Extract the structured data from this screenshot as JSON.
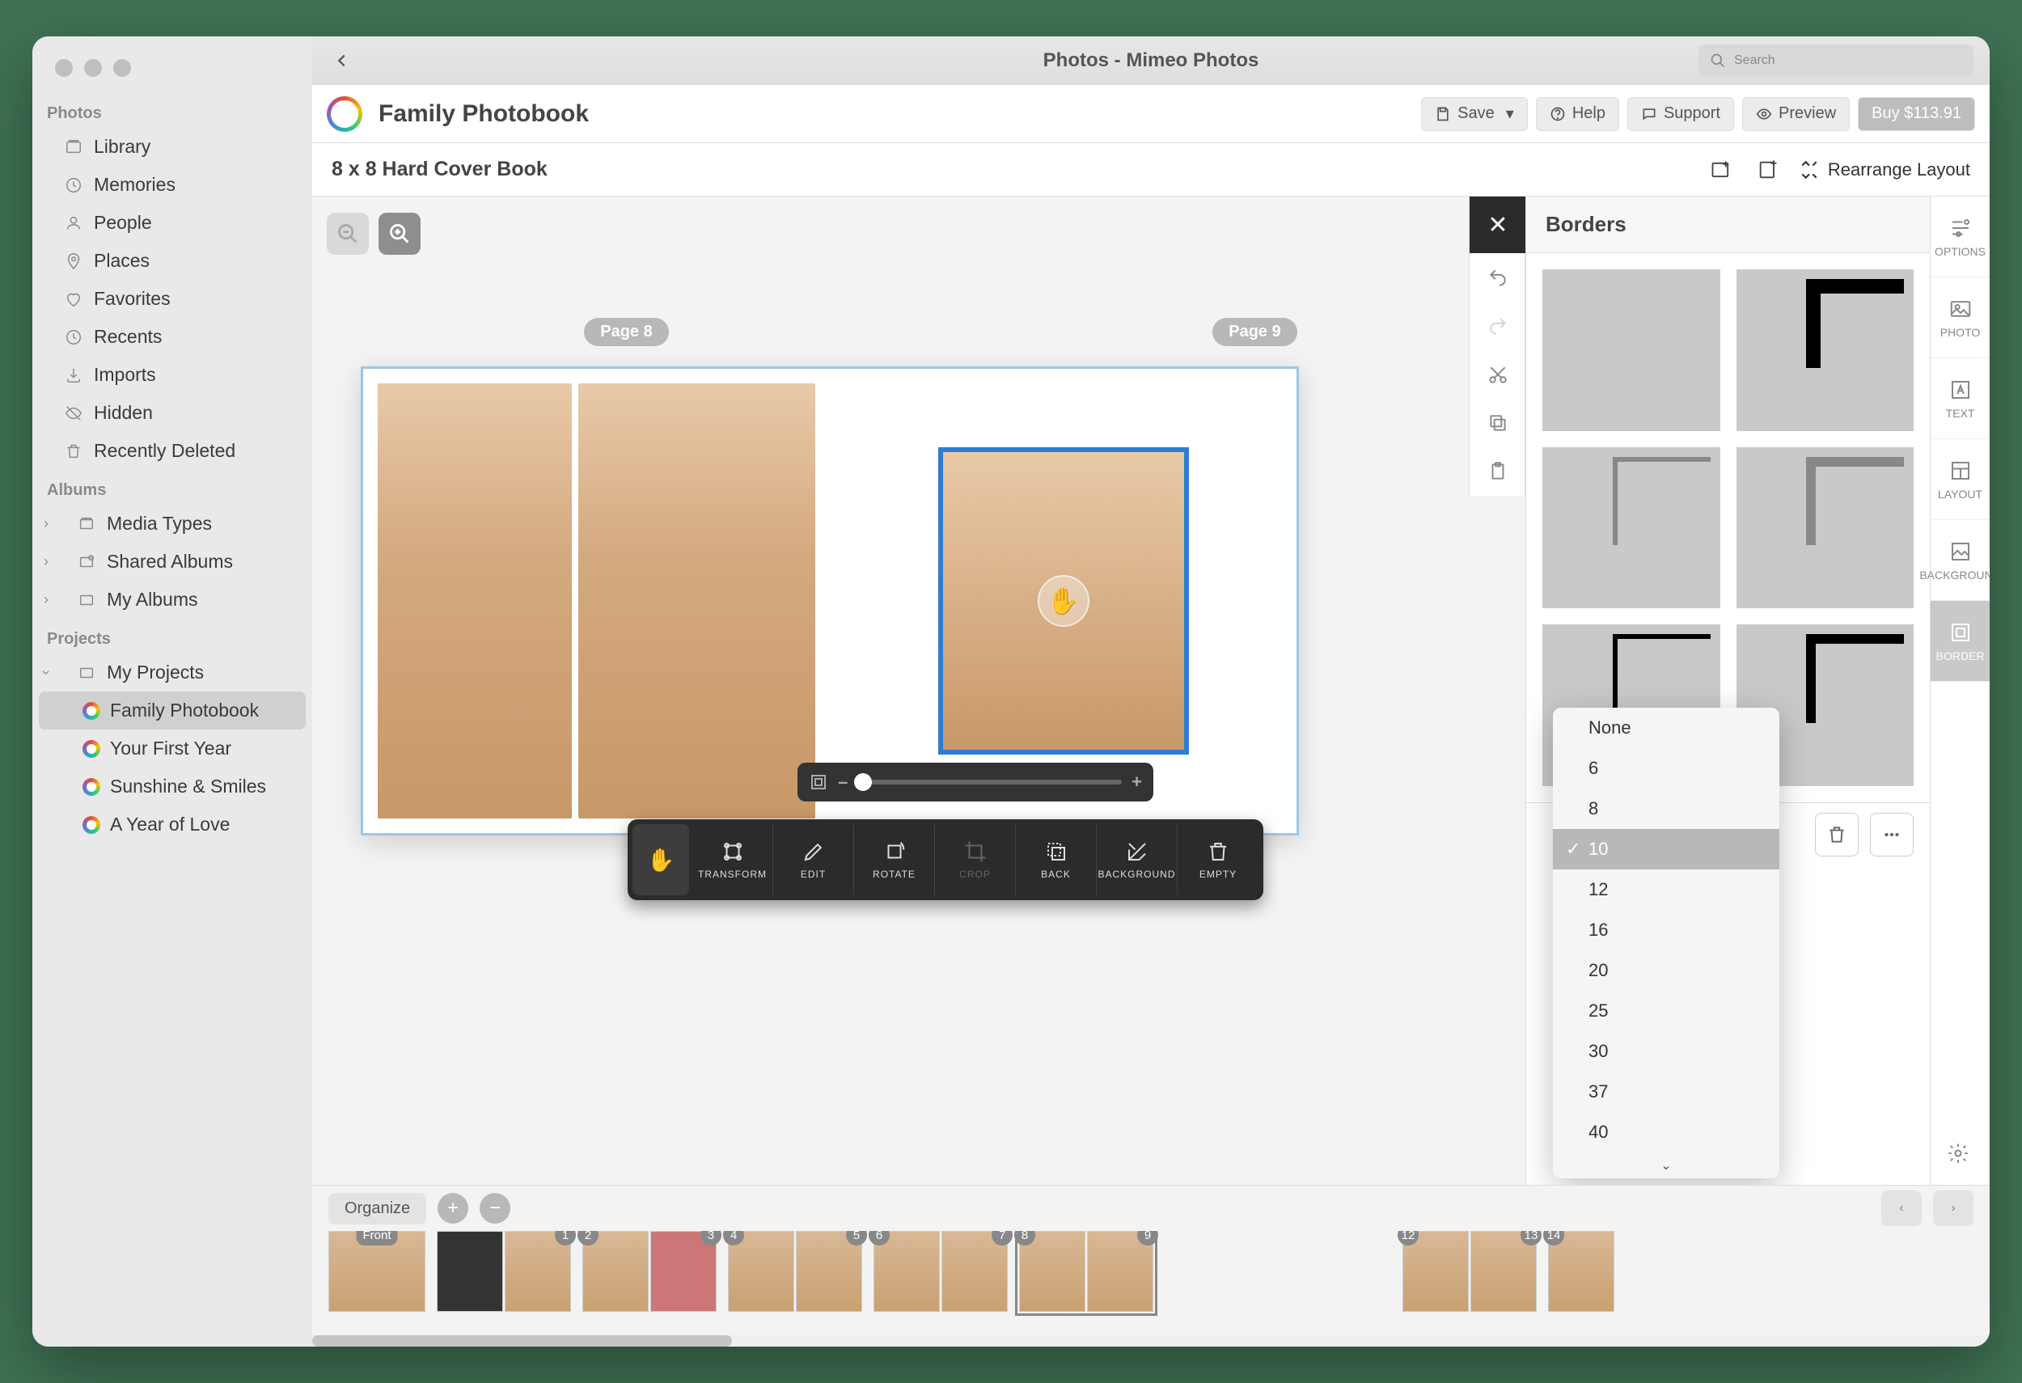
{
  "window": {
    "title": "Photos - Mimeo Photos",
    "search_placeholder": "Search"
  },
  "sidebar": {
    "sections": {
      "photos": "Photos",
      "albums": "Albums",
      "projects": "Projects"
    },
    "photos_items": [
      "Library",
      "Memories",
      "People",
      "Places",
      "Favorites",
      "Recents",
      "Imports",
      "Hidden",
      "Recently Deleted"
    ],
    "albums_items": [
      "Media Types",
      "Shared Albums",
      "My Albums"
    ],
    "my_projects": "My Projects",
    "project_items": [
      "Family Photobook",
      "Your First Year",
      "Sunshine & Smiles",
      "A Year of Love"
    ],
    "active_project_index": 0
  },
  "toolbar": {
    "doc_title": "Family Photobook",
    "save": "Save",
    "help": "Help",
    "support": "Support",
    "preview": "Preview",
    "buy": "Buy $113.91"
  },
  "subbar": {
    "product": "8 x 8 Hard Cover Book",
    "rearrange": "Rearrange Layout"
  },
  "canvas": {
    "page_left": "Page 8",
    "page_right": "Page 9",
    "zoom_minus": "–",
    "zoom_plus": "+"
  },
  "float_tools": {
    "transform": "TRANSFORM",
    "edit": "EDIT",
    "rotate": "ROTATE",
    "crop": "CROP",
    "back": "BACK",
    "background": "BACKGROUND",
    "empty": "EMPTY"
  },
  "side_tabs": {
    "options": "OPTIONS",
    "photo": "PHOTO",
    "text": "TEXT",
    "layout": "LAYOUT",
    "background": "BACKGROUND",
    "border": "BORDER"
  },
  "borders_panel": {
    "title": "Borders"
  },
  "border_sizes": [
    "None",
    "6",
    "8",
    "10",
    "12",
    "16",
    "20",
    "25",
    "30",
    "37",
    "40"
  ],
  "border_selected": "10",
  "thumbbar": {
    "organize": "Organize",
    "front": "Front",
    "page_numbers": [
      "1",
      "2",
      "3",
      "4",
      "5",
      "6",
      "7",
      "8",
      "9",
      "12",
      "13",
      "14"
    ],
    "selected_spread": "8-9"
  }
}
